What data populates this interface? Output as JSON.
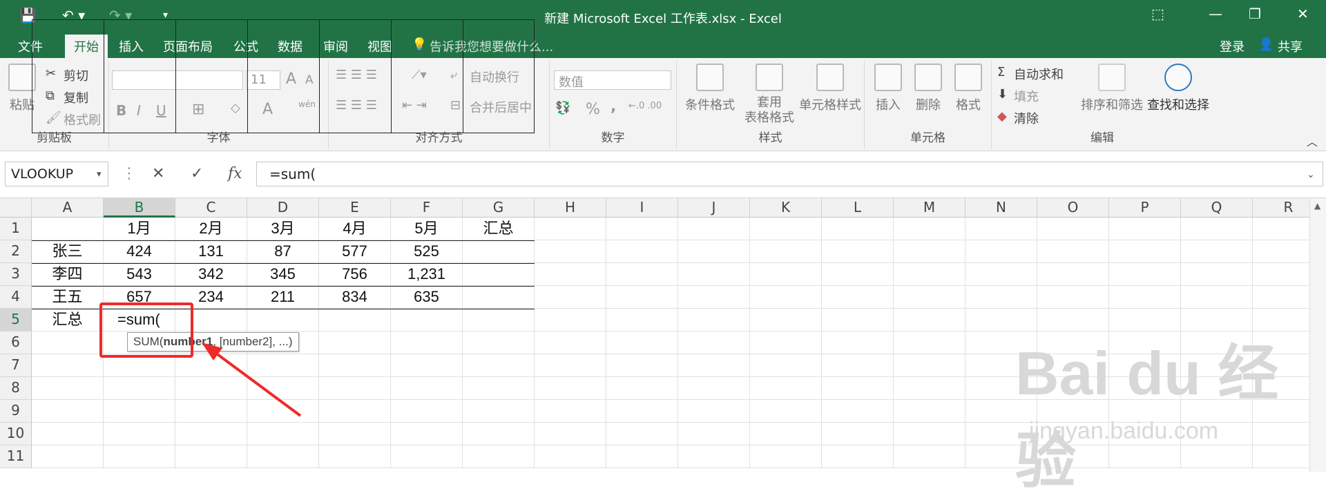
{
  "title": "新建 Microsoft Excel 工作表.xlsx - Excel",
  "tabs": [
    "文件",
    "开始",
    "插入",
    "页面布局",
    "公式",
    "数据",
    "审阅",
    "视图"
  ],
  "tell_me": "告诉我您想要做什么...",
  "login": "登录",
  "share": "共享",
  "ribbon": {
    "clipboard": {
      "paste": "粘贴",
      "cut": "剪切",
      "copy": "复制",
      "format_painter": "格式刷",
      "title": "剪贴板"
    },
    "font": {
      "size": "11",
      "bold": "B",
      "italic": "I",
      "underline": "U",
      "grow": "A",
      "shrink": "A",
      "title": "字体",
      "wen": "wén"
    },
    "align": {
      "wrap": "自动换行",
      "merge": "合并后居中",
      "title": "对齐方式"
    },
    "number": {
      "format": "数值",
      "percent": "%",
      "comma": ",",
      "title": "数字"
    },
    "styles": {
      "conditional": "条件格式",
      "table_fmt_1": "套用",
      "table_fmt_2": "表格格式",
      "cell_styles": "单元格样式",
      "title": "样式"
    },
    "cells": {
      "insert": "插入",
      "delete": "删除",
      "format": "格式",
      "title": "单元格"
    },
    "editing": {
      "autosum": "自动求和",
      "fill": "填充",
      "clear": "清除",
      "sort": "排序和筛选",
      "find": "查找和选择",
      "title": "编辑"
    }
  },
  "formula_bar": {
    "name_box": "VLOOKUP",
    "formula": "=sum(",
    "fx": "fx"
  },
  "columns": [
    "A",
    "B",
    "C",
    "D",
    "E",
    "F",
    "G",
    "H",
    "I",
    "J",
    "K",
    "L",
    "M",
    "N",
    "O",
    "P",
    "Q",
    "R"
  ],
  "rows": [
    "1",
    "2",
    "3",
    "4",
    "5",
    "6",
    "7",
    "8",
    "9",
    "10",
    "11"
  ],
  "cells": [
    [
      "",
      "1月",
      "2月",
      "3月",
      "4月",
      "5月",
      "汇总"
    ],
    [
      "张三",
      "424",
      "131",
      "87",
      "577",
      "525",
      ""
    ],
    [
      "李四",
      "543",
      "342",
      "345",
      "756",
      "1,231",
      ""
    ],
    [
      "王五",
      "657",
      "234",
      "211",
      "834",
      "635",
      ""
    ],
    [
      "汇总",
      "=sum(",
      "",
      "",
      "",
      "",
      ""
    ]
  ],
  "tooltip": {
    "pre": "SUM(",
    "bold": "number1",
    "post": ", [number2], ...)"
  },
  "watermark": {
    "main": "Bai du 经验",
    "sub": "jingyan.baidu.com"
  },
  "colors": {
    "excel_green": "#217346",
    "annotation_red": "#ee2a2a"
  }
}
